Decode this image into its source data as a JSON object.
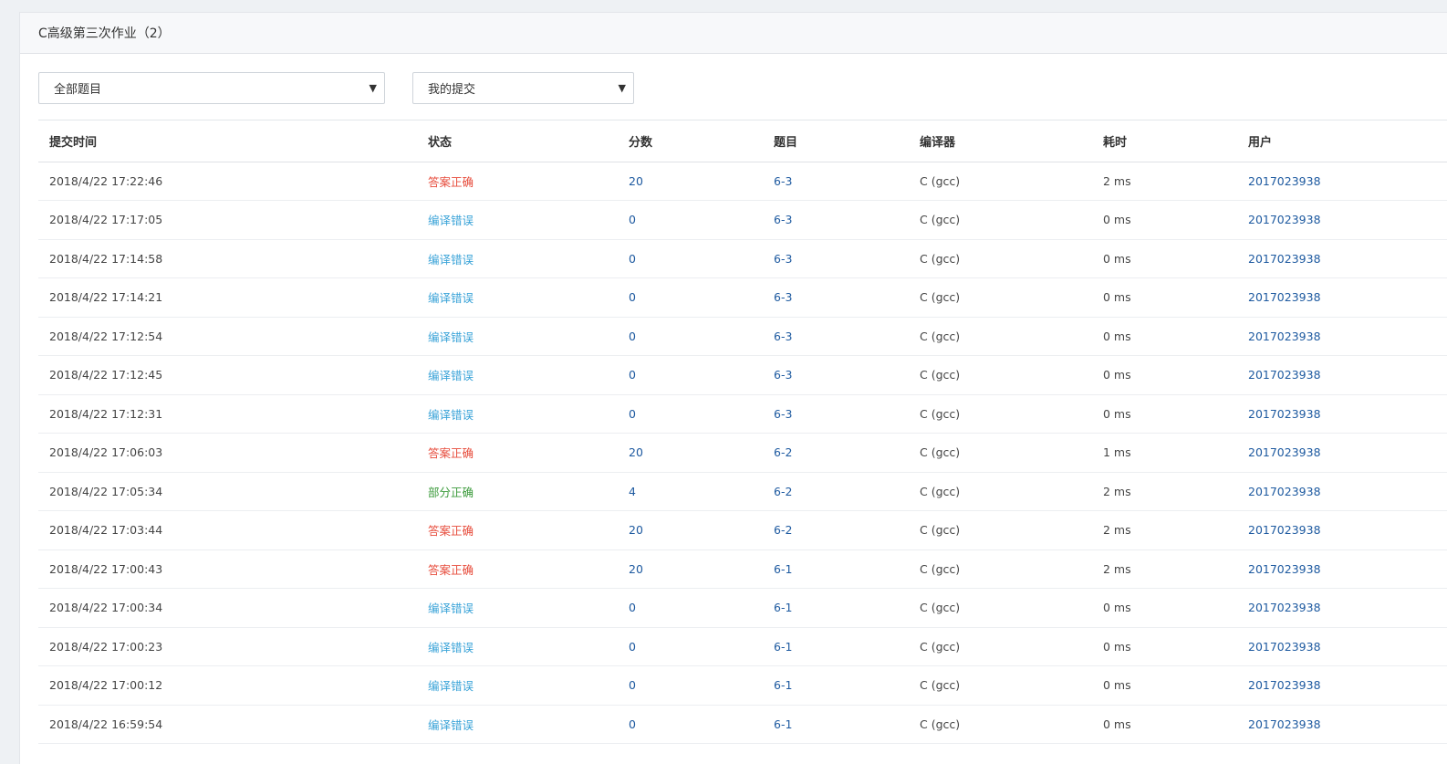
{
  "panel": {
    "title": "C高级第三次作业（2）"
  },
  "filters": {
    "problem": {
      "selected": "全部题目",
      "arrow_icon": "caret-down-icon"
    },
    "submission": {
      "selected": "我的提交",
      "arrow_icon": "caret-down-icon"
    }
  },
  "table": {
    "headers": [
      "提交时间",
      "状态",
      "分数",
      "题目",
      "编译器",
      "耗时",
      "用户"
    ],
    "status_colors": {
      "答案正确": "#e74c3c",
      "编译错误": "#3aa3d8",
      "部分正确": "#3c9b3c"
    },
    "rows": [
      {
        "time": "2018/4/22 17:22:46",
        "status": "答案正确",
        "score": "20",
        "problem": "6-3",
        "compiler": "C (gcc)",
        "duration": "2 ms",
        "user": "2017023938"
      },
      {
        "time": "2018/4/22 17:17:05",
        "status": "编译错误",
        "score": "0",
        "problem": "6-3",
        "compiler": "C (gcc)",
        "duration": "0 ms",
        "user": "2017023938"
      },
      {
        "time": "2018/4/22 17:14:58",
        "status": "编译错误",
        "score": "0",
        "problem": "6-3",
        "compiler": "C (gcc)",
        "duration": "0 ms",
        "user": "2017023938"
      },
      {
        "time": "2018/4/22 17:14:21",
        "status": "编译错误",
        "score": "0",
        "problem": "6-3",
        "compiler": "C (gcc)",
        "duration": "0 ms",
        "user": "2017023938"
      },
      {
        "time": "2018/4/22 17:12:54",
        "status": "编译错误",
        "score": "0",
        "problem": "6-3",
        "compiler": "C (gcc)",
        "duration": "0 ms",
        "user": "2017023938"
      },
      {
        "time": "2018/4/22 17:12:45",
        "status": "编译错误",
        "score": "0",
        "problem": "6-3",
        "compiler": "C (gcc)",
        "duration": "0 ms",
        "user": "2017023938"
      },
      {
        "time": "2018/4/22 17:12:31",
        "status": "编译错误",
        "score": "0",
        "problem": "6-3",
        "compiler": "C (gcc)",
        "duration": "0 ms",
        "user": "2017023938"
      },
      {
        "time": "2018/4/22 17:06:03",
        "status": "答案正确",
        "score": "20",
        "problem": "6-2",
        "compiler": "C (gcc)",
        "duration": "1 ms",
        "user": "2017023938"
      },
      {
        "time": "2018/4/22 17:05:34",
        "status": "部分正确",
        "score": "4",
        "problem": "6-2",
        "compiler": "C (gcc)",
        "duration": "2 ms",
        "user": "2017023938"
      },
      {
        "time": "2018/4/22 17:03:44",
        "status": "答案正确",
        "score": "20",
        "problem": "6-2",
        "compiler": "C (gcc)",
        "duration": "2 ms",
        "user": "2017023938"
      },
      {
        "time": "2018/4/22 17:00:43",
        "status": "答案正确",
        "score": "20",
        "problem": "6-1",
        "compiler": "C (gcc)",
        "duration": "2 ms",
        "user": "2017023938"
      },
      {
        "time": "2018/4/22 17:00:34",
        "status": "编译错误",
        "score": "0",
        "problem": "6-1",
        "compiler": "C (gcc)",
        "duration": "0 ms",
        "user": "2017023938"
      },
      {
        "time": "2018/4/22 17:00:23",
        "status": "编译错误",
        "score": "0",
        "problem": "6-1",
        "compiler": "C (gcc)",
        "duration": "0 ms",
        "user": "2017023938"
      },
      {
        "time": "2018/4/22 17:00:12",
        "status": "编译错误",
        "score": "0",
        "problem": "6-1",
        "compiler": "C (gcc)",
        "duration": "0 ms",
        "user": "2017023938"
      },
      {
        "time": "2018/4/22 16:59:54",
        "status": "编译错误",
        "score": "0",
        "problem": "6-1",
        "compiler": "C (gcc)",
        "duration": "0 ms",
        "user": "2017023938"
      }
    ]
  }
}
